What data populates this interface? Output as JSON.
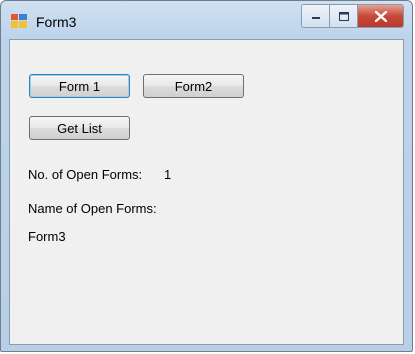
{
  "window": {
    "title": "Form3"
  },
  "buttons": {
    "form1": "Form 1",
    "form2": "Form2",
    "get_list": "Get List"
  },
  "labels": {
    "open_forms_count_label": "No. of Open Forms:",
    "open_forms_count_value": "1",
    "open_forms_names_label": "Name of Open Forms:",
    "open_forms_names_value": "Form3"
  },
  "icons": {
    "app": "form-app-icon",
    "minimize": "minimize-icon",
    "maximize": "maximize-icon",
    "close": "close-icon"
  }
}
